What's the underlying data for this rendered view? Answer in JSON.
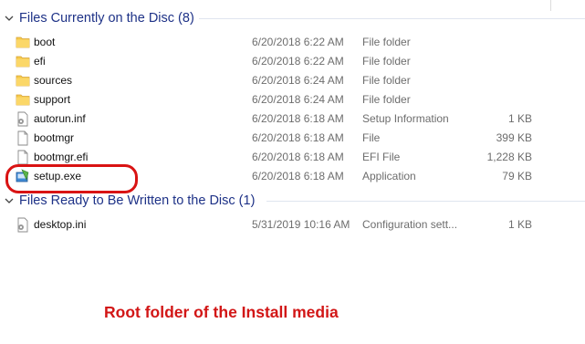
{
  "groups": [
    {
      "title": "Files Currently on the Disc (8)",
      "items": [
        {
          "name": "boot",
          "date": "6/20/2018 6:22 AM",
          "type": "File folder",
          "size": "",
          "icon": "folder-icon"
        },
        {
          "name": "efi",
          "date": "6/20/2018 6:22 AM",
          "type": "File folder",
          "size": "",
          "icon": "folder-icon"
        },
        {
          "name": "sources",
          "date": "6/20/2018 6:24 AM",
          "type": "File folder",
          "size": "",
          "icon": "folder-icon"
        },
        {
          "name": "support",
          "date": "6/20/2018 6:24 AM",
          "type": "File folder",
          "size": "",
          "icon": "folder-icon"
        },
        {
          "name": "autorun.inf",
          "date": "6/20/2018 6:18 AM",
          "type": "Setup Information",
          "size": "1 KB",
          "icon": "settings-file-icon"
        },
        {
          "name": "bootmgr",
          "date": "6/20/2018 6:18 AM",
          "type": "File",
          "size": "399 KB",
          "icon": "file-icon"
        },
        {
          "name": "bootmgr.efi",
          "date": "6/20/2018 6:18 AM",
          "type": "EFI File",
          "size": "1,228 KB",
          "icon": "file-icon"
        },
        {
          "name": "setup.exe",
          "date": "6/20/2018 6:18 AM",
          "type": "Application",
          "size": "79 KB",
          "icon": "setup-app-icon"
        }
      ]
    },
    {
      "title": "Files Ready to Be Written to the Disc (1)",
      "items": [
        {
          "name": "desktop.ini",
          "date": "5/31/2019 10:16 AM",
          "type": "Configuration sett...",
          "size": "1 KB",
          "icon": "settings-file-icon"
        }
      ]
    }
  ],
  "annotation": {
    "caption": "Root folder of the Install media",
    "color": "#d21616"
  }
}
